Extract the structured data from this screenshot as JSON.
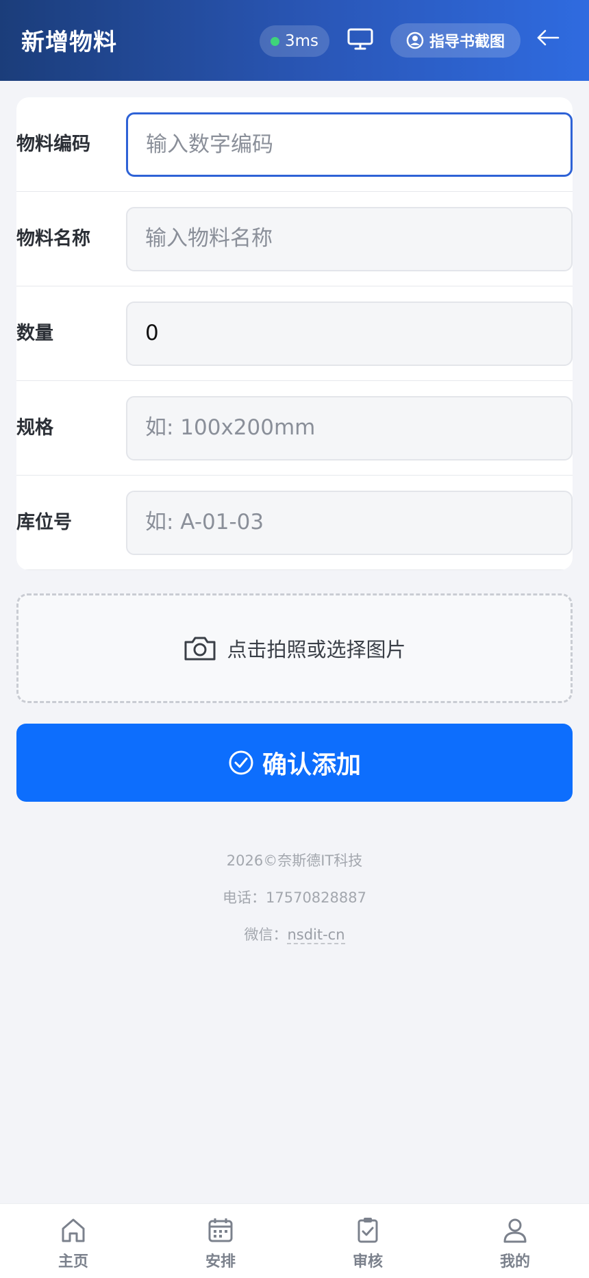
{
  "header": {
    "title": "新增物料",
    "ping": "3ms",
    "guide_label": "指导书截图"
  },
  "form": {
    "fields": [
      {
        "label": "物料编码",
        "placeholder": "输入数字编码",
        "value": ""
      },
      {
        "label": "物料名称",
        "placeholder": "输入物料名称",
        "value": ""
      },
      {
        "label": "数量",
        "placeholder": "",
        "value": "0"
      },
      {
        "label": "规格",
        "placeholder": "如: 100x200mm",
        "value": ""
      },
      {
        "label": "库位号",
        "placeholder": "如: A-01-03",
        "value": ""
      }
    ],
    "upload_label": "点击拍照或选择图片",
    "confirm_label": "确认添加"
  },
  "footer": {
    "copyright": "2026©奈斯德IT科技",
    "phone_prefix": "电话：",
    "phone": "17570828887",
    "wechat_prefix": "微信：",
    "wechat": "nsdit-cn"
  },
  "tabbar": {
    "items": [
      {
        "label": "主页",
        "icon": "home-icon"
      },
      {
        "label": "安排",
        "icon": "calendar-icon"
      },
      {
        "label": "审核",
        "icon": "clipboard-check-icon"
      },
      {
        "label": "我的",
        "icon": "user-icon"
      }
    ]
  },
  "colors": {
    "primary": "#0d6efd",
    "header_start": "#1b3d7a",
    "header_end": "#2f6be0",
    "status_dot": "#3ed47a"
  }
}
